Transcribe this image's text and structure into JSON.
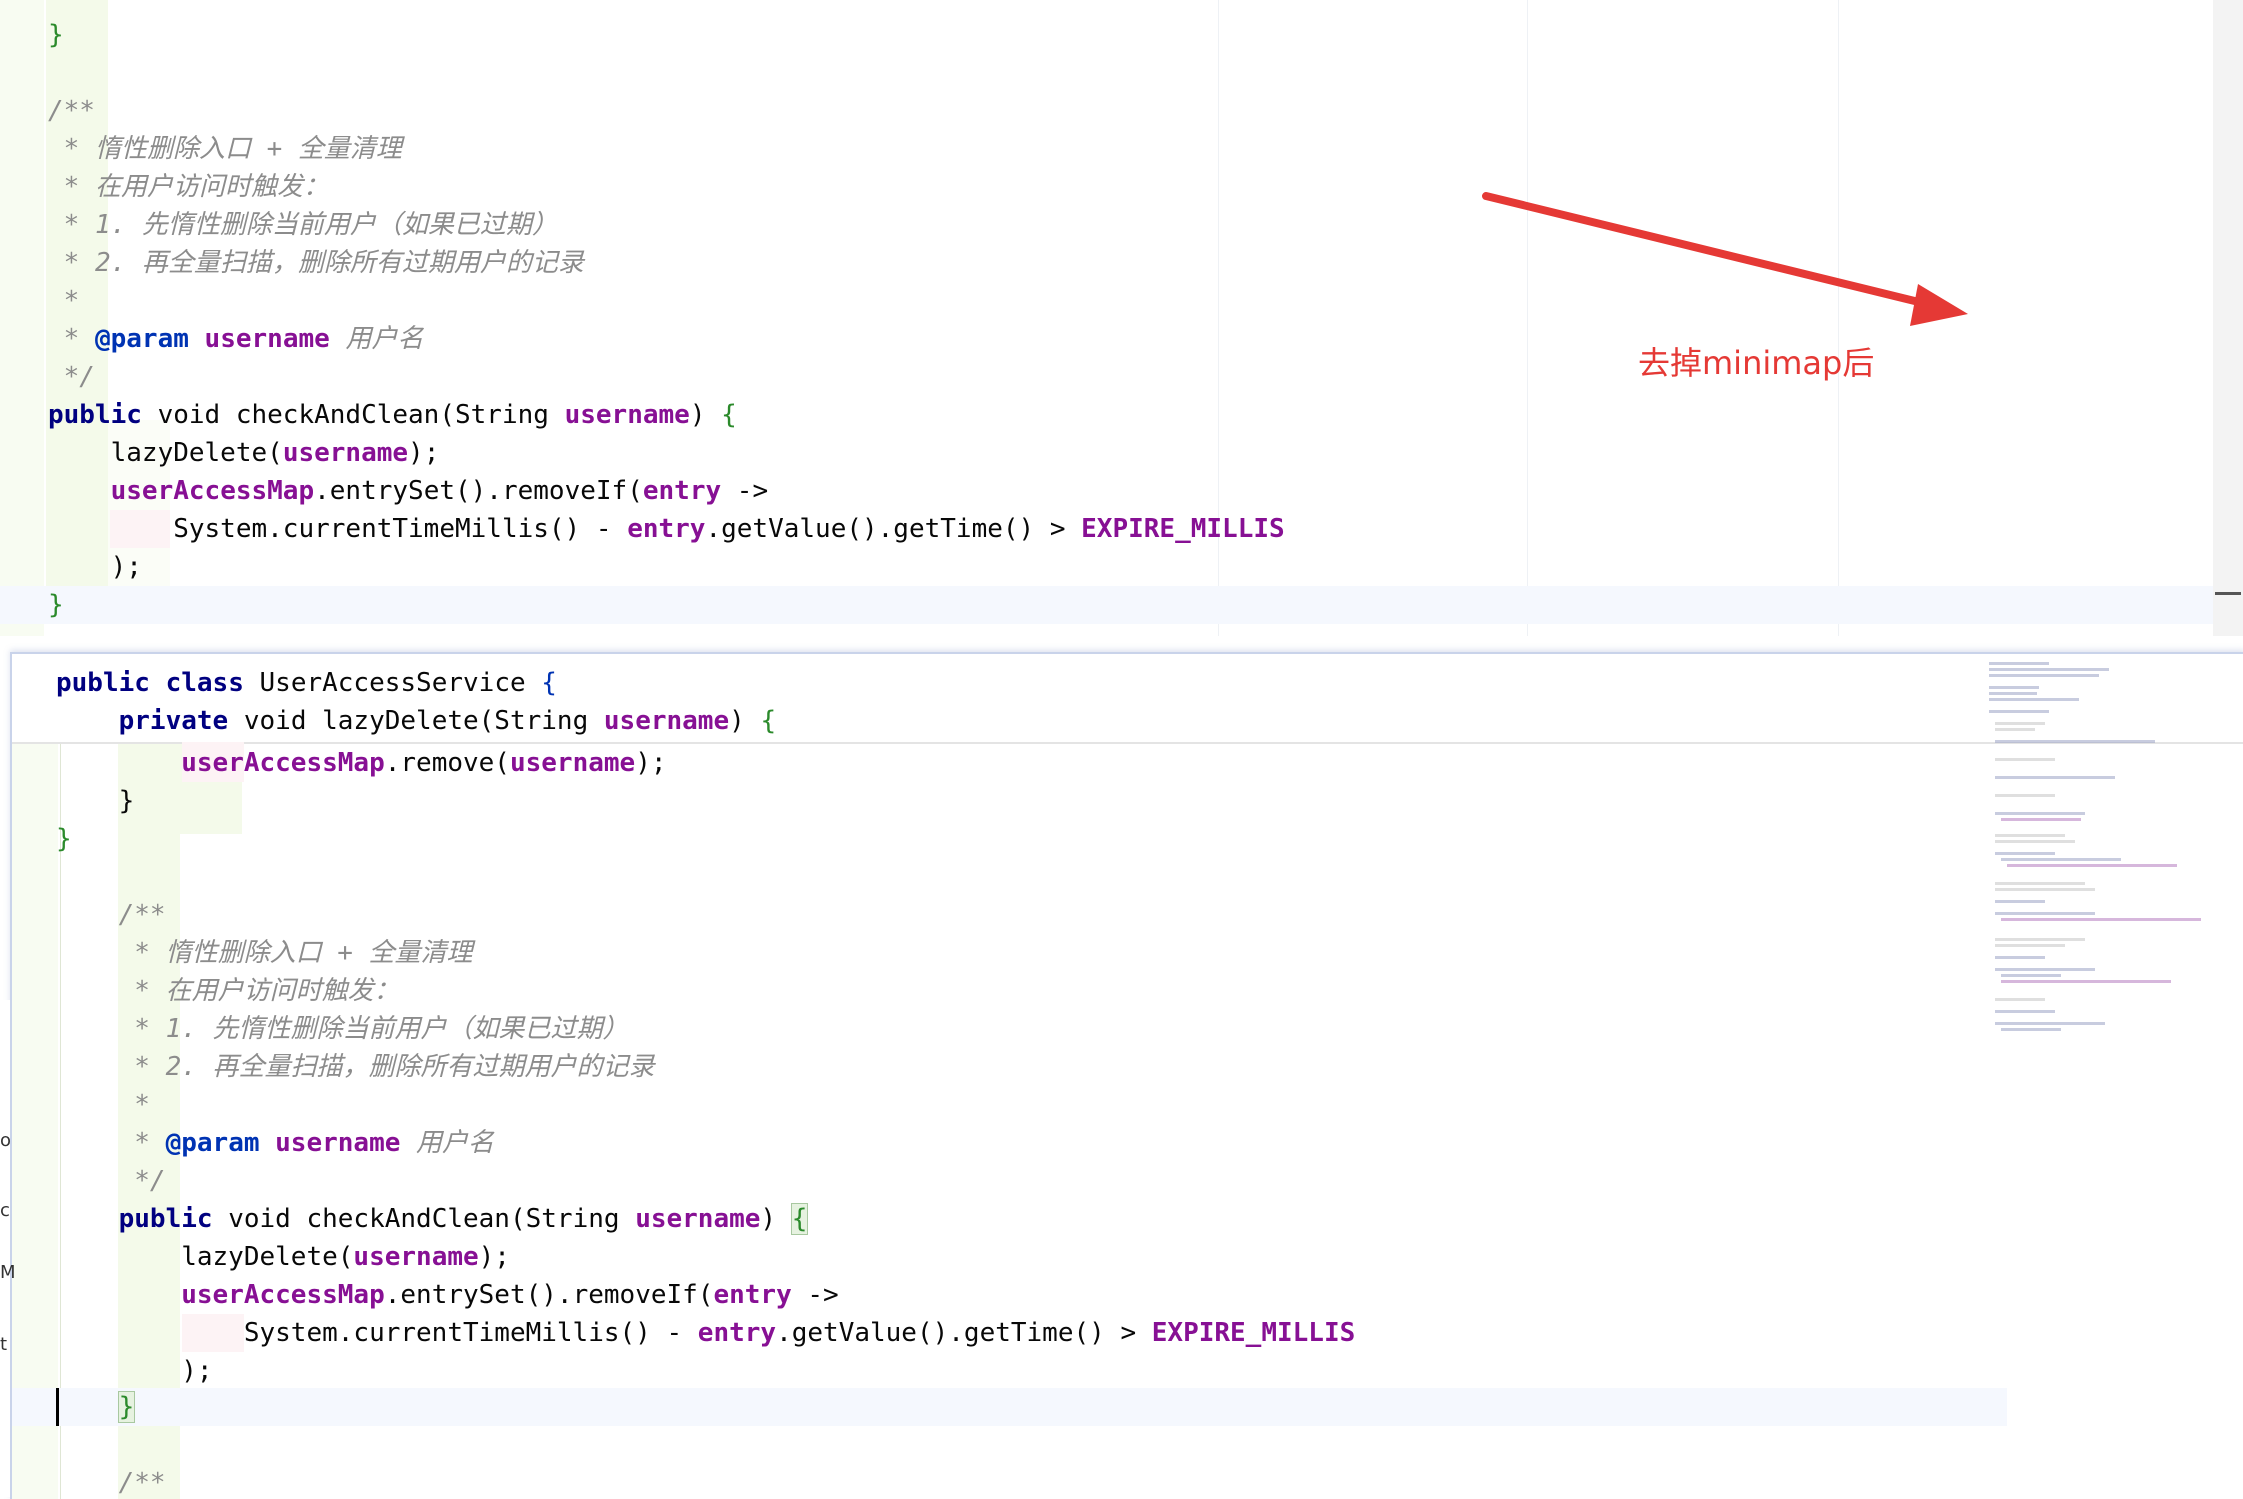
{
  "annotation": {
    "label": "去掉minimap后",
    "arrow_color": "#e53935"
  },
  "top_editor": {
    "lines": [
      "}",
      "",
      "/**",
      " * 惰性删除入口 + 全量清理",
      " * 在用户访问时触发：",
      " * 1. 先惰性删除当前用户（如果已过期）",
      " * 2. 再全量扫描，删除所有过期用户的记录",
      " *",
      " * @param username 用户名",
      " */",
      "public void checkAndClean(String username) {",
      "    lazyDelete(username);",
      "    userAccessMap.entrySet().removeIf(entry ->",
      "        System.currentTimeMillis() - entry.getValue().getTime() > EXPIRE_MILLIS",
      "    );",
      "}"
    ]
  },
  "bottom_editor": {
    "sticky_header": [
      "public class UserAccessService {",
      "    private void lazyDelete(String username) {"
    ],
    "lines": [
      "        userAccessMap.remove(username);",
      "    }",
      "}",
      "",
      "/**",
      " * 惰性删除入口 + 全量清理",
      " * 在用户访问时触发：",
      " * 1. 先惰性删除当前用户（如果已过期）",
      " * 2. 再全量扫描，删除所有过期用户的记录",
      " *",
      " * @param username 用户名",
      " */",
      "public void checkAndClean(String username) {",
      "    lazyDelete(username);",
      "    userAccessMap.entrySet().removeIf(entry ->",
      "        System.currentTimeMillis() - entry.getValue().getTime() > EXPIRE_MILLIS",
      "    );",
      "}",
      "",
      "/**"
    ]
  },
  "left_edge_marks": [
    "o",
    "c",
    "M",
    "t"
  ]
}
